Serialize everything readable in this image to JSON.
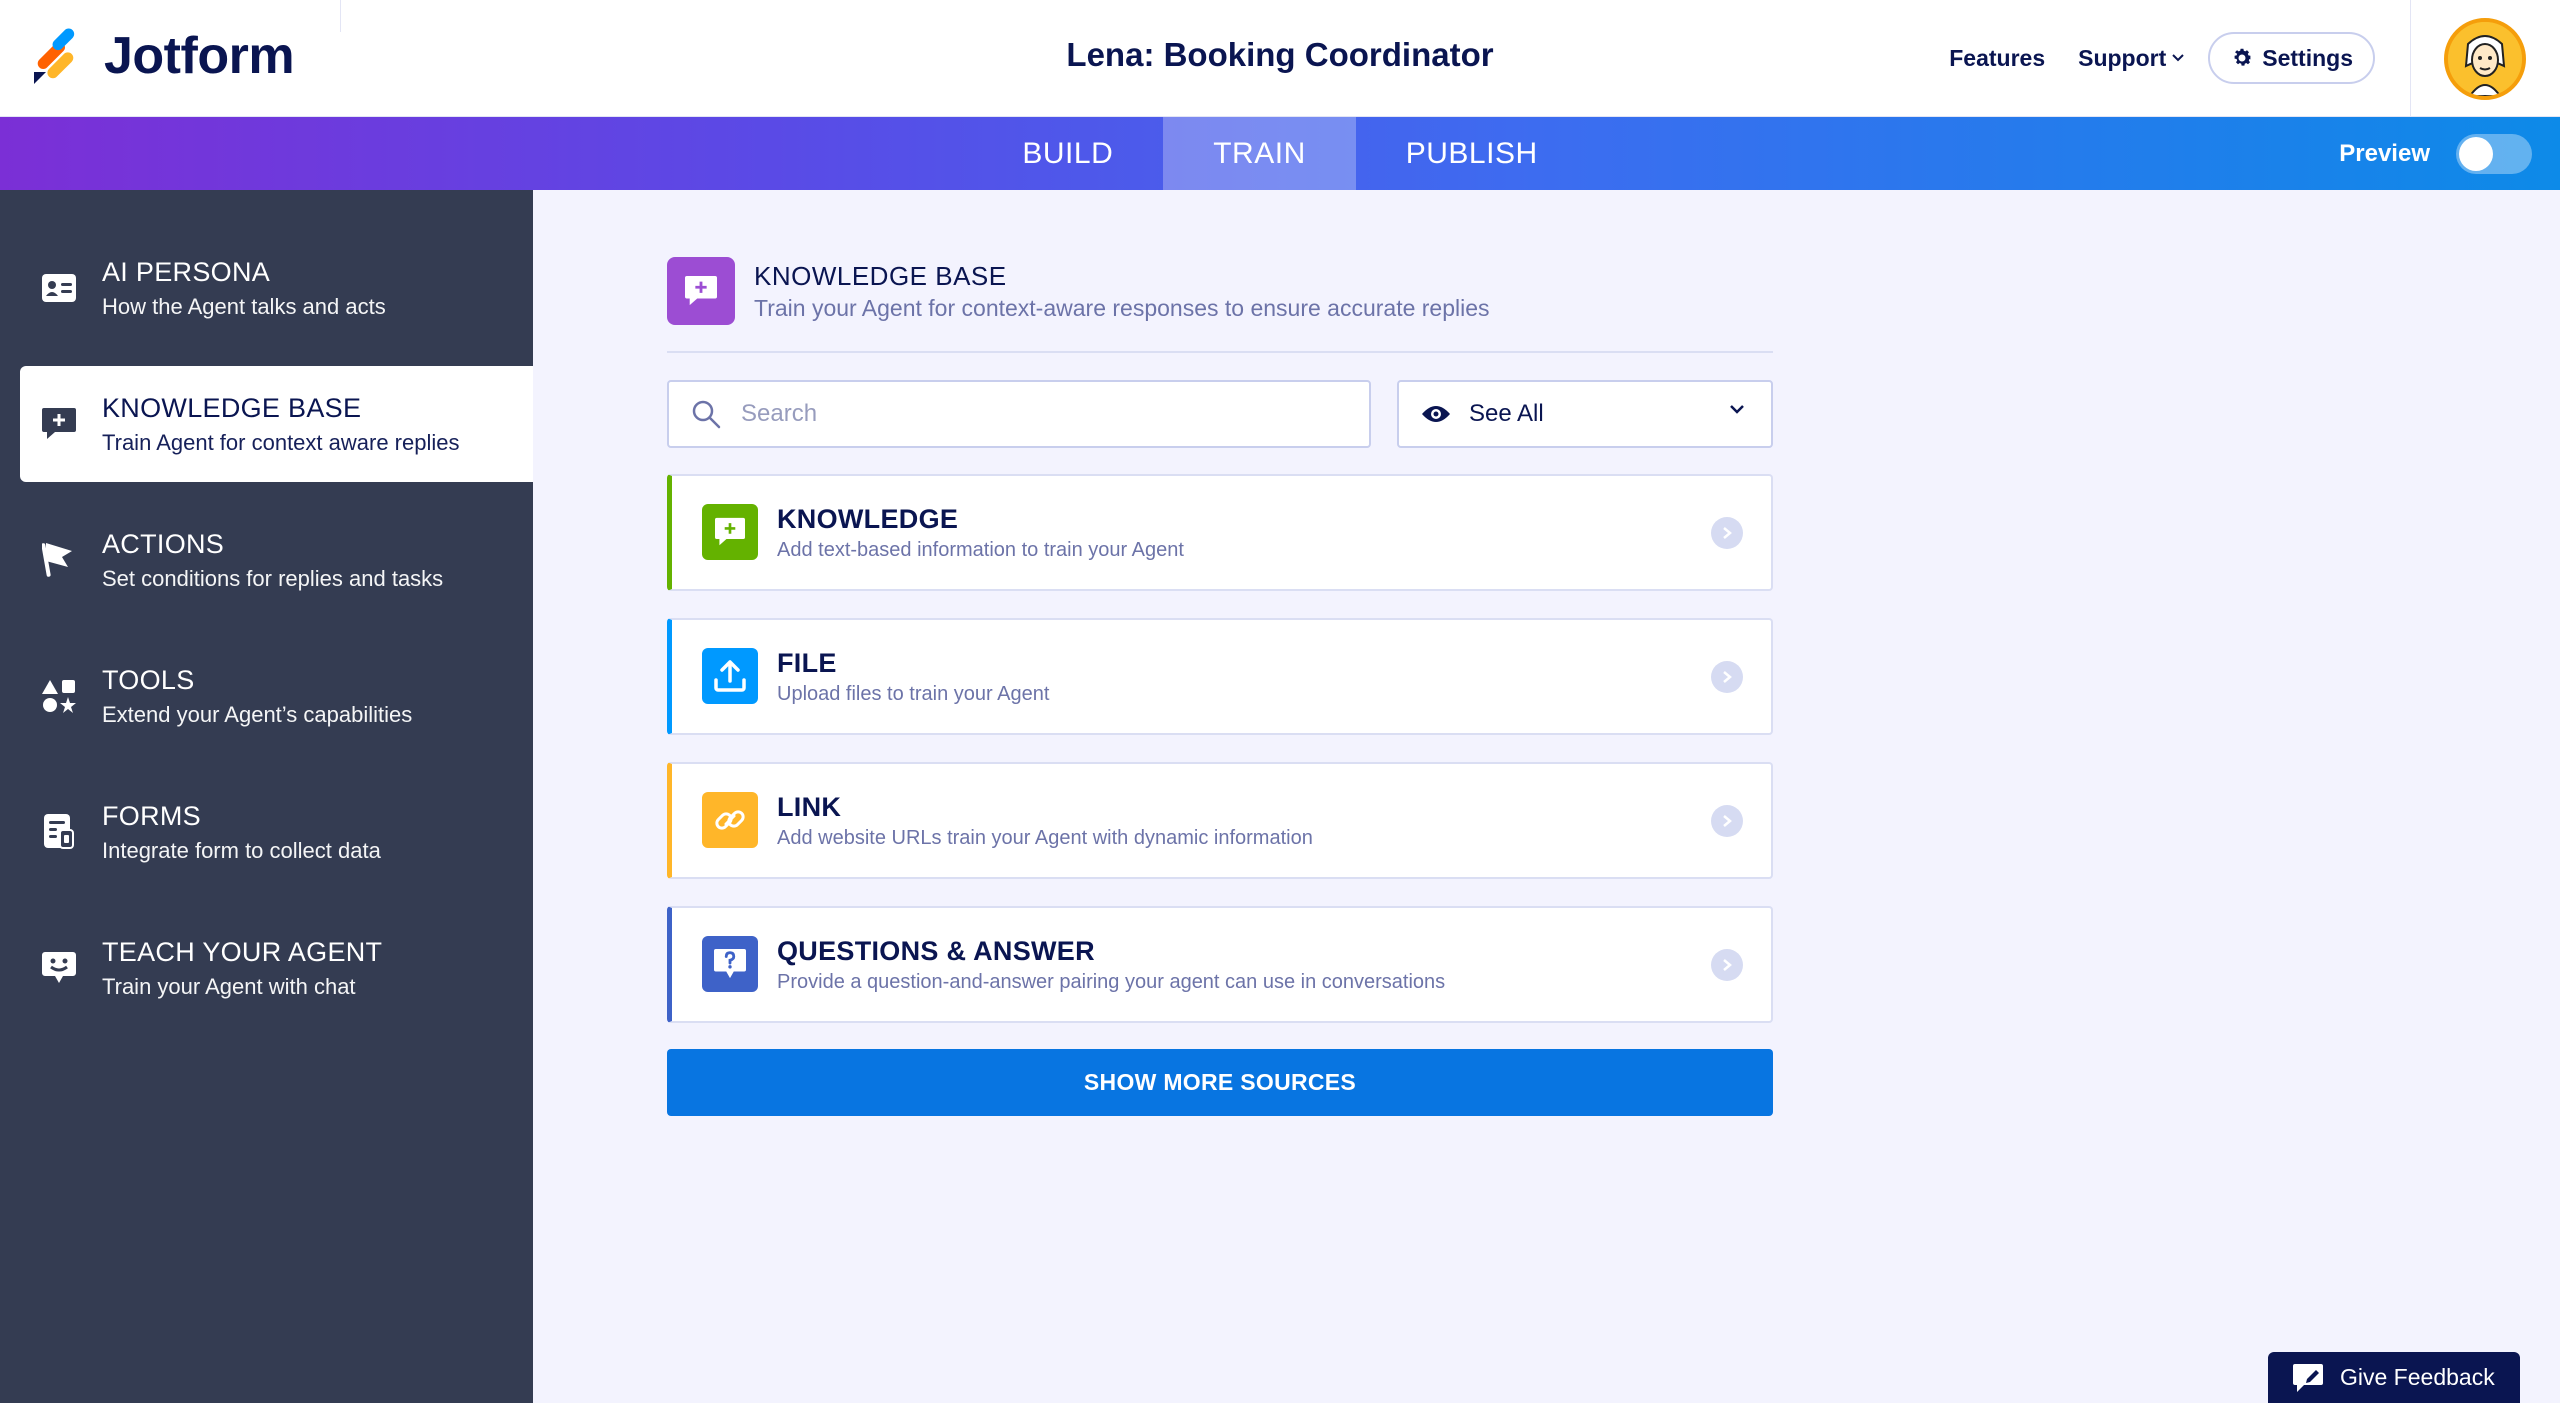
{
  "app": {
    "name": "Jotform"
  },
  "header": {
    "title": "Lena: Booking Coordinator",
    "links": {
      "features": "Features",
      "support": "Support",
      "settings": "Settings"
    },
    "icons": {
      "settings": "gear-icon",
      "support": "chevron-down-icon",
      "avatar": "user-avatar"
    }
  },
  "tabs": [
    {
      "label": "BUILD",
      "active": false
    },
    {
      "label": "TRAIN",
      "active": true
    },
    {
      "label": "PUBLISH",
      "active": false
    }
  ],
  "preview": {
    "label": "Preview",
    "enabled": false
  },
  "sidebar": {
    "items": [
      {
        "title": "AI PERSONA",
        "subtitle": "How the Agent talks and acts",
        "icon": "id-card-icon",
        "active": false
      },
      {
        "title": "KNOWLEDGE BASE",
        "subtitle": "Train Agent for context aware replies",
        "icon": "chat-plus-icon",
        "active": true
      },
      {
        "title": "ACTIONS",
        "subtitle": "Set conditions for replies and tasks",
        "icon": "flag-icon",
        "active": false
      },
      {
        "title": "TOOLS",
        "subtitle": "Extend your Agent’s capabilities",
        "icon": "shapes-icon",
        "active": false
      },
      {
        "title": "FORMS",
        "subtitle": "Integrate form to collect data",
        "icon": "form-icon",
        "active": false
      },
      {
        "title": "TEACH YOUR AGENT",
        "subtitle": "Train your Agent with chat",
        "icon": "smile-chat-icon",
        "active": false
      }
    ]
  },
  "main": {
    "title": "KNOWLEDGE BASE",
    "subtitle": "Train your Agent for context-aware responses to ensure accurate replies",
    "search": {
      "placeholder": "Search",
      "value": ""
    },
    "filter": {
      "label": "See All",
      "icon": "eye-icon"
    },
    "sources": [
      {
        "title": "KNOWLEDGE",
        "subtitle": "Add text-based information to train your Agent",
        "icon": "chat-plus-icon",
        "color": "#64b200"
      },
      {
        "title": "FILE",
        "subtitle": "Upload files to train your Agent",
        "icon": "upload-icon",
        "color": "#0099ff"
      },
      {
        "title": "LINK",
        "subtitle": "Add website URLs train your Agent with dynamic information",
        "icon": "link-icon",
        "color": "#ffb629"
      },
      {
        "title": "QUESTIONS & ANSWER",
        "subtitle": "Provide a question-and-answer pairing your agent can use in conversations",
        "icon": "question-chat-icon",
        "color": "#3e62c8"
      }
    ],
    "show_more": "SHOW MORE SOURCES"
  },
  "feedback": {
    "label": "Give Feedback"
  },
  "colors": {
    "accent": "#0875e1",
    "sidebar": "#343c52",
    "knowledge_icon": "#9c4dd3"
  }
}
